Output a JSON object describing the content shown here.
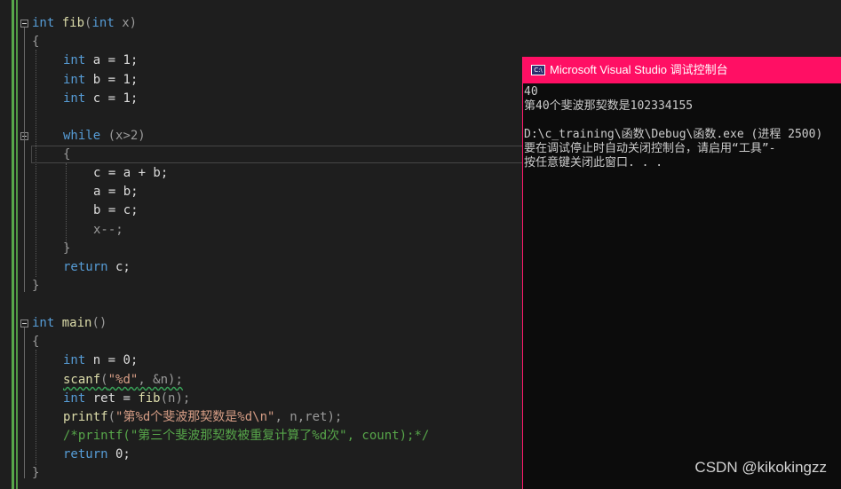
{
  "editor": {
    "fib_header": {
      "t1": "int",
      "t2": " ",
      "t3": "fib",
      "t4": "(",
      "t5": "int",
      "t6": " x)"
    },
    "open_brace_1": "{",
    "decl_a": {
      "kw": "int",
      "rest": " a = 1;"
    },
    "decl_b": {
      "kw": "int",
      "rest": " b = 1;"
    },
    "decl_c": {
      "kw": "int",
      "rest": " c = 1;"
    },
    "while_line": {
      "kw": "while",
      "rest": " (x>2)"
    },
    "open_brace_2": "{",
    "assign_c": "c = a + b;",
    "assign_a": "a = b;",
    "assign_b": "b = c;",
    "decrement": "x--;",
    "close_brace_2": "}",
    "return_c": {
      "kw": "return",
      "rest": " c;"
    },
    "close_brace_1": "}",
    "main_header": {
      "kw": "int",
      "sp": " ",
      "fn": "main",
      "rest": "()"
    },
    "open_brace_3": "{",
    "decl_n": {
      "kw": "int",
      "rest": " n = 0;"
    },
    "scanf_line": {
      "fn": "scanf",
      "p1": "(",
      "str": "\"%d\"",
      "p2": ", &n);"
    },
    "ret_line": {
      "kw": "int",
      "rest1": " ret = ",
      "fn": "fib",
      "rest2": "(n);"
    },
    "printf_line": {
      "fn": "printf",
      "p1": "(",
      "str": "\"第%d个斐波那契数是%d\\n\"",
      "p2": ", n,ret);"
    },
    "comment_line": "/*printf(\"第三个斐波那契数被重复计算了%d次\", count);*/",
    "return_0": {
      "kw": "return",
      "rest": " 0;"
    },
    "close_brace_3": "}"
  },
  "console": {
    "title": "Microsoft Visual Studio 调试控制台",
    "icon_label": "C:\\",
    "lines": [
      "40",
      "第40个斐波那契数是102334155",
      "",
      "D:\\c_training\\函数\\Debug\\函数.exe (进程 2500)",
      "要在调试停止时自动关闭控制台，请启用“工具”-",
      "按任意键关闭此窗口. . ."
    ]
  },
  "watermark": "CSDN @kikokingzz",
  "colors": {
    "keyword": "#569cd6",
    "function": "#dcdcaa",
    "string": "#d69d85",
    "comment": "#57a64a",
    "console_title": "#ff0f64"
  }
}
